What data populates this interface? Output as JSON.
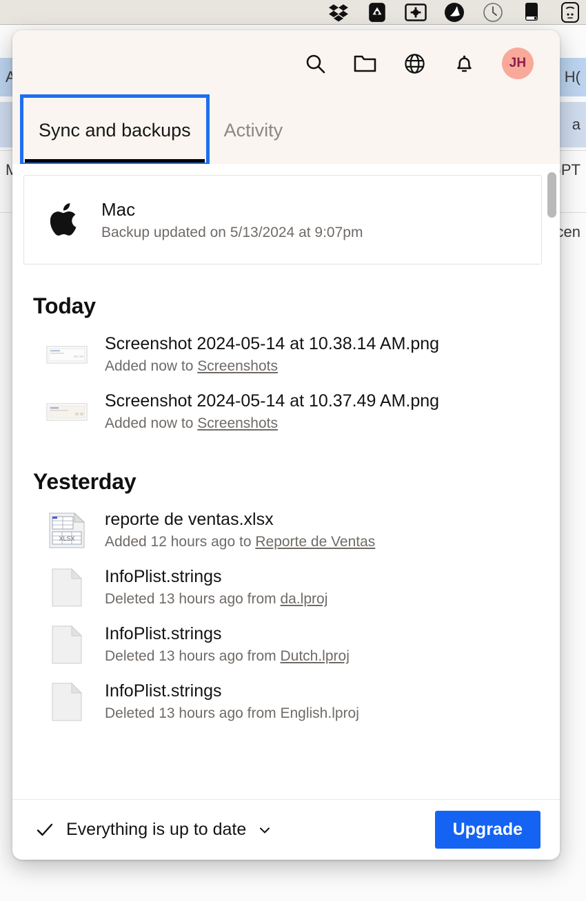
{
  "menubar": {
    "icons": [
      {
        "name": "dropbox-icon"
      },
      {
        "name": "drive-icon"
      },
      {
        "name": "display-settings-icon"
      },
      {
        "name": "adobe-icon"
      },
      {
        "name": "clock-icon"
      },
      {
        "name": "battery-icon"
      },
      {
        "name": "control-center-icon"
      }
    ]
  },
  "background": {
    "rows": [
      {
        "text": "Ac",
        "right": "H("
      },
      {
        "text": "",
        "right": "a"
      },
      {
        "text": "Ma",
        "right": "GPT"
      },
      {
        "text": "",
        "right": "cen"
      }
    ]
  },
  "popover": {
    "header": {
      "icons": [
        {
          "name": "search-icon",
          "label": "Search"
        },
        {
          "name": "folder-icon",
          "label": "Open Dropbox folder"
        },
        {
          "name": "globe-icon",
          "label": "Open dropbox.com"
        },
        {
          "name": "bell-icon",
          "label": "Notifications"
        }
      ],
      "avatar": {
        "initials": "JH",
        "bg": "#f9a99a",
        "fg": "#8c1d4a"
      }
    },
    "tabs": [
      {
        "label": "Sync and backups",
        "active": true,
        "focused": true
      },
      {
        "label": "Activity",
        "active": false,
        "focused": false
      }
    ],
    "device": {
      "icon": "apple-logo-icon",
      "name": "Mac",
      "status": "Backup updated on 5/13/2024 at 9:07pm"
    },
    "sections": [
      {
        "heading": "Today",
        "items": [
          {
            "thumb": "screenshot-thumbnail",
            "title": "Screenshot 2024-05-14 at 10.38.14 AM.png",
            "action": "Added now to ",
            "link": "Screenshots"
          },
          {
            "thumb": "screenshot-thumbnail",
            "title": "Screenshot 2024-05-14 at 10.37.49 AM.png",
            "action": "Added now to ",
            "link": "Screenshots"
          }
        ]
      },
      {
        "heading": "Yesterday",
        "items": [
          {
            "thumb": "xlsx-file-icon",
            "title": "reporte de ventas.xlsx",
            "action": "Added 12 hours ago to ",
            "link": "Reporte de Ventas"
          },
          {
            "thumb": "generic-file-icon",
            "title": "InfoPlist.strings",
            "action": "Deleted 13 hours ago from ",
            "link": "da.lproj"
          },
          {
            "thumb": "generic-file-icon",
            "title": "InfoPlist.strings",
            "action": "Deleted 13 hours ago from ",
            "link": "Dutch.lproj"
          },
          {
            "thumb": "generic-file-icon",
            "title": "InfoPlist.strings",
            "action": "Deleted 13 hours ago from ",
            "link": "English.lproj"
          }
        ]
      }
    ],
    "footer": {
      "status_icon": "checkmark-icon",
      "status_text": "Everything is up to date",
      "chevron": "chevron-down-icon",
      "upgrade_label": "Upgrade",
      "upgrade_color": "#1463f3"
    }
  }
}
